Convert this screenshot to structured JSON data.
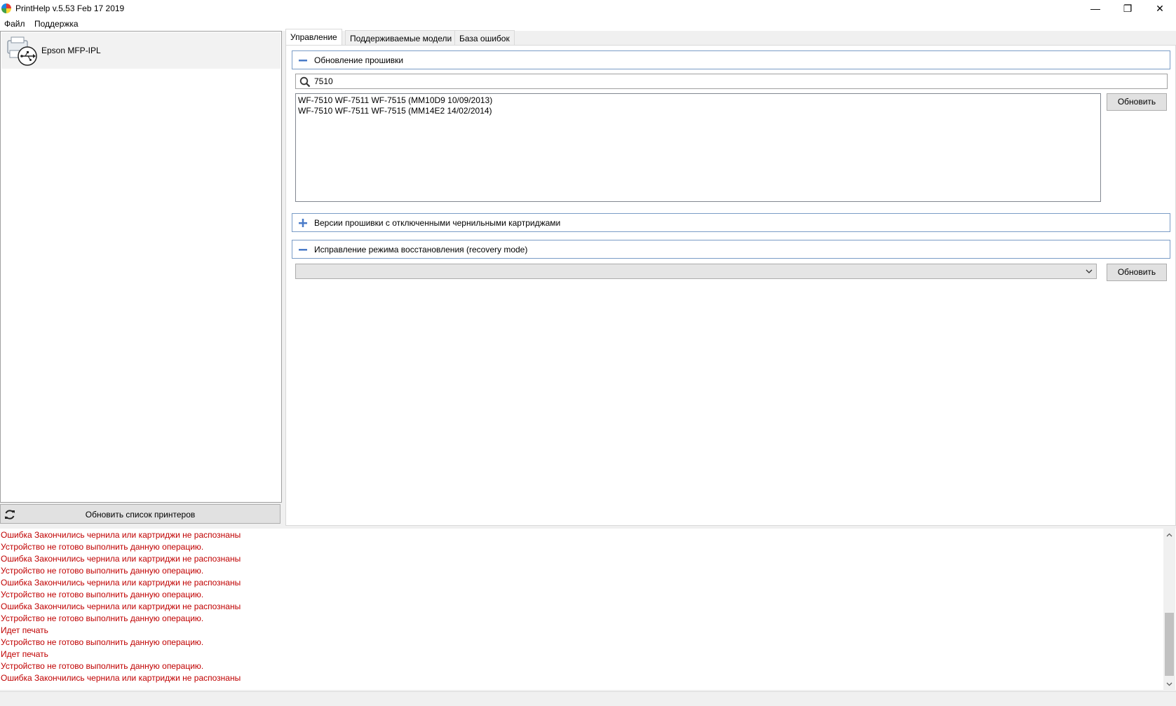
{
  "window": {
    "title": "PrintHelp v.5.53 Feb 17 2019",
    "minimize": "—",
    "maximize": "❐",
    "close": "✕"
  },
  "menu": {
    "items": [
      "Файл",
      "Поддержка"
    ]
  },
  "printers": {
    "items": [
      {
        "name": "Epson MFP-IPL",
        "icon": "printer-usb-icon"
      }
    ],
    "refresh_label": "Обновить список принтеров"
  },
  "tabs": [
    {
      "label": "Управление",
      "active": true
    },
    {
      "label": "Поддерживаемые модели",
      "active": false
    },
    {
      "label": "База ошибок",
      "active": false
    }
  ],
  "firmware_update": {
    "header": "Обновление прошивки",
    "state": "expanded",
    "search_value": "7510",
    "list": [
      "WF-7510 WF-7511 WF-7515 (MM10D9 10/09/2013)",
      "WF-7510 WF-7511 WF-7515 (MM14E2 14/02/2014)"
    ],
    "update_label": "Обновить"
  },
  "firmware_no_chip": {
    "header": "Версии прошивки с отключенными чернильными картриджами",
    "state": "collapsed"
  },
  "recovery": {
    "header": "Исправление режима восстановления (recovery mode)",
    "state": "expanded",
    "selected": "",
    "update_label": "Обновить"
  },
  "log": {
    "lines": [
      "Ошибка Закончились чернила или картриджи не распознаны",
      "Устройство не готово выполнить данную операцию.",
      "Ошибка Закончились чернила или картриджи не распознаны",
      "Устройство не готово выполнить данную операцию.",
      "Ошибка Закончились чернила или картриджи не распознаны",
      "Устройство не готово выполнить данную операцию.",
      "Ошибка Закончились чернила или картриджи не распознаны",
      "Устройство не готово выполнить данную операцию.",
      "Идет печать",
      "Устройство не готово выполнить данную операцию.",
      "Идет печать",
      "Устройство не готово выполнить данную операцию.",
      "Ошибка Закончились чернила или картриджи не распознаны"
    ],
    "color": "#c00000"
  },
  "colors": {
    "group_border": "#7a9cc6",
    "log_text": "#c00000"
  }
}
